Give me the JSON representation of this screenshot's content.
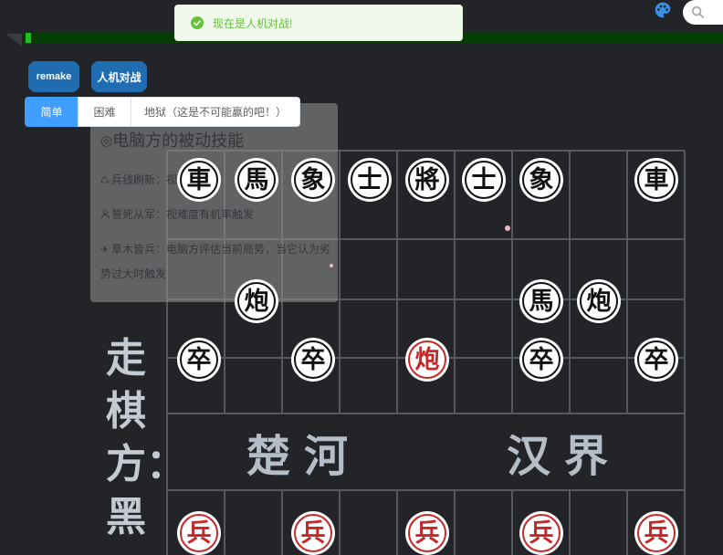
{
  "toast": {
    "message": "现在是人机对战!",
    "icon": "check-circle-icon"
  },
  "header": {
    "theme_icon": "palette-icon",
    "search": {
      "icon": "search-icon",
      "value": ""
    }
  },
  "timer_bar": {
    "fill_fraction": 0.008
  },
  "controls": {
    "remake_label": "remake",
    "mode_label": "人机对战"
  },
  "difficulty": {
    "options": [
      "简单",
      "困难",
      "地狱（这是不可能赢的吧！）"
    ],
    "selected_index": 0
  },
  "skills_panel": {
    "title_icon": "target-icon",
    "title": "电脑方的被动技能",
    "items": [
      {
        "icon": "recycle-icon",
        "text": "兵线刷新：视"
      },
      {
        "icon": "user-icon",
        "text": "誓死从军：视难度有机率触发"
      },
      {
        "icon": "plane-icon",
        "text": "草木皆兵：电脑方评估当前局势，当它认为劣势过大时触发"
      }
    ]
  },
  "turn": {
    "label": "走棋方：",
    "side": "黑"
  },
  "river": {
    "left": "楚河",
    "right": "汉界"
  },
  "board": {
    "pieces": [
      {
        "char": "車",
        "color": "#111111",
        "col": 0,
        "row": 0
      },
      {
        "char": "馬",
        "color": "#111111",
        "col": 1,
        "row": 0
      },
      {
        "char": "象",
        "color": "#111111",
        "col": 2,
        "row": 0
      },
      {
        "char": "士",
        "color": "#111111",
        "col": 3,
        "row": 0
      },
      {
        "char": "將",
        "color": "#111111",
        "col": 4,
        "row": 0
      },
      {
        "char": "士",
        "color": "#111111",
        "col": 5,
        "row": 0
      },
      {
        "char": "象",
        "color": "#111111",
        "col": 6,
        "row": 0
      },
      {
        "char": "車",
        "color": "#111111",
        "col": 8,
        "row": 0
      },
      {
        "char": "炮",
        "color": "#111111",
        "col": 1,
        "row": 2
      },
      {
        "char": "馬",
        "color": "#111111",
        "col": 6,
        "row": 2
      },
      {
        "char": "炮",
        "color": "#111111",
        "col": 7,
        "row": 2
      },
      {
        "char": "卒",
        "color": "#111111",
        "col": 0,
        "row": 3
      },
      {
        "char": "卒",
        "color": "#111111",
        "col": 2,
        "row": 3
      },
      {
        "char": "炮",
        "color": "#c62828",
        "col": 4,
        "row": 3
      },
      {
        "char": "卒",
        "color": "#111111",
        "col": 6,
        "row": 3
      },
      {
        "char": "卒",
        "color": "#111111",
        "col": 8,
        "row": 3
      },
      {
        "char": "兵",
        "color": "#c62828",
        "col": 0,
        "row": 6
      },
      {
        "char": "兵",
        "color": "#c62828",
        "col": 2,
        "row": 6
      },
      {
        "char": "兵",
        "color": "#c62828",
        "col": 4,
        "row": 6
      },
      {
        "char": "兵",
        "color": "#c62828",
        "col": 6,
        "row": 6
      },
      {
        "char": "兵",
        "color": "#c62828",
        "col": 8,
        "row": 6
      }
    ]
  },
  "colors": {
    "background": "#222428",
    "accent_blue": "#409eff",
    "button_blue": "#1f6cb0",
    "toast_green": "#67c23a",
    "board_line": "#55585e",
    "timer_fill": "#1fbf1f",
    "timer_track": "#053d05",
    "red_piece": "#c62828",
    "black_piece": "#111111"
  }
}
